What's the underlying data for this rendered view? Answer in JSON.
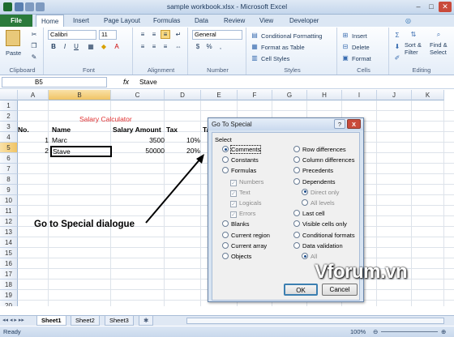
{
  "window": {
    "title": "sample workbook.xlsx - Microsoft Excel"
  },
  "tabs": [
    "File",
    "Home",
    "Insert",
    "Page Layout",
    "Formulas",
    "Data",
    "Review",
    "View",
    "Developer"
  ],
  "ribbon": {
    "clipboard": {
      "paste": "Paste",
      "label": "Clipboard"
    },
    "font": {
      "name": "Calibri",
      "size": "11",
      "label": "Font"
    },
    "alignment": {
      "label": "Alignment"
    },
    "number": {
      "format": "General",
      "currency": "$",
      "percent": "%",
      "comma": ",",
      "label": "Number"
    },
    "styles": {
      "conditional": "Conditional Formatting",
      "table": "Format as Table",
      "cell": "Cell Styles",
      "label": "Styles"
    },
    "cells": {
      "insert": "Insert",
      "delete": "Delete",
      "format": "Format",
      "label": "Cells"
    },
    "editing": {
      "sort": "Sort &",
      "filter": "Filter",
      "find": "Find &",
      "select": "Select",
      "label": "Editing"
    }
  },
  "formula_bar": {
    "name_box": "B5",
    "fx": "fx",
    "value": "Stave"
  },
  "grid": {
    "columns": [
      "A",
      "B",
      "C",
      "D",
      "E",
      "F",
      "G",
      "H",
      "I",
      "J",
      "K"
    ],
    "rows": [
      "1",
      "2",
      "3",
      "4",
      "5",
      "6",
      "7",
      "8",
      "9",
      "10",
      "11",
      "12",
      "13",
      "14",
      "15",
      "16",
      "17",
      "18",
      "19",
      "20"
    ],
    "title": "Salary Calculator",
    "headers": {
      "no": "No.",
      "name": "Name",
      "salary": "Salary Amount",
      "tax": "Tax",
      "e": "Ta"
    },
    "data": [
      {
        "no": "1",
        "name": "Marc",
        "salary": "3500",
        "tax": "10%"
      },
      {
        "no": "2",
        "name": "Stave",
        "salary": "50000",
        "tax": "20%"
      }
    ]
  },
  "sheets": [
    "Sheet1",
    "Sheet2",
    "Sheet3"
  ],
  "status": {
    "ready": "Ready",
    "zoom": "100%"
  },
  "dialog": {
    "title": "Go To Special",
    "help": "?",
    "close": "X",
    "select_label": "Select",
    "left": [
      {
        "label": "Comments",
        "type": "radio",
        "checked": true
      },
      {
        "label": "Constants",
        "type": "radio"
      },
      {
        "label": "Formulas",
        "type": "radio"
      },
      {
        "label": "Numbers",
        "type": "check",
        "disabled": true
      },
      {
        "label": "Text",
        "type": "check",
        "disabled": true
      },
      {
        "label": "Logicals",
        "type": "check",
        "disabled": true
      },
      {
        "label": "Errors",
        "type": "check",
        "disabled": true
      },
      {
        "label": "Blanks",
        "type": "radio"
      },
      {
        "label": "Current region",
        "type": "radio"
      },
      {
        "label": "Current array",
        "type": "radio"
      },
      {
        "label": "Objects",
        "type": "radio"
      }
    ],
    "right": [
      {
        "label": "Row differences",
        "type": "radio"
      },
      {
        "label": "Column differences",
        "type": "radio"
      },
      {
        "label": "Precedents",
        "type": "radio"
      },
      {
        "label": "Dependents",
        "type": "radio"
      },
      {
        "label": "Direct only",
        "type": "radio",
        "disabled": true,
        "checked": true
      },
      {
        "label": "All levels",
        "type": "radio",
        "disabled": true
      },
      {
        "label": "Last cell",
        "type": "radio"
      },
      {
        "label": "Visible cells only",
        "type": "radio"
      },
      {
        "label": "Conditional formats",
        "type": "radio"
      },
      {
        "label": "Data validation",
        "type": "radio"
      },
      {
        "label": "All",
        "type": "radio",
        "disabled": true,
        "checked": true
      }
    ],
    "ok": "OK",
    "cancel": "Cancel"
  },
  "annotation": "Go to Special dialogue",
  "watermark": "Vforum.vn"
}
